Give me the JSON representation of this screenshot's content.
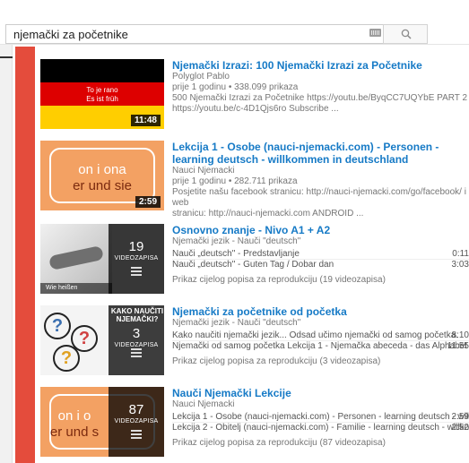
{
  "search": {
    "value": "njemački za početnike"
  },
  "colors": {
    "accent_red": "#e44c3c",
    "link_blue": "#167ac6"
  },
  "results": [
    {
      "title": "Njemački Izrazi: 100 Njemački Izrazi za Početnike",
      "channel": "Polyglot Pablo",
      "stats": "prije 1 godinu • 338.099 prikaza",
      "desc1": "500 Njemački Izrazi za Početnike https://youtu.be/ByqCC7UQYbE PART 2",
      "desc2": "https://youtu.be/c-4D1Qjs6ro Subscribe ...",
      "duration": "11:48",
      "thumb_text1": "To je rano",
      "thumb_text2": "Es ist früh"
    },
    {
      "title": "Lekcija 1 - Osobe (nauci-njemacki.com) - Personen - learning deutsch - willkommen in deutschland",
      "channel": "Nauci Njemacki",
      "stats": "prije 1 godinu • 282.711 prikaza",
      "desc1": "Posjetite našu facebook stranicu: http://nauci-njemacki.com/go/facebook/ i web",
      "desc2": "stranicu: http://nauci-njemacki.com ANDROID ...",
      "duration": "2:59",
      "thumb_text1": "on i ona",
      "thumb_text2": "er und sie"
    },
    {
      "title": "Osnovno znanje - Nivo A1 + A2",
      "channel": "Njemački jezik - Nauči \"deutsch\"",
      "count": "19",
      "count_label": "VIDEOZAPISA",
      "thumb_caption": "Wie heißen",
      "rows": [
        {
          "text": "Nauči „deutsch\" - Predstavljanje",
          "dur": "0:11"
        },
        {
          "text": "Nauči „deutsch\" - Guten Tag / Dobar dan",
          "dur": "3:03"
        }
      ],
      "view_all": "Prikaz cijelog popisa za reprodukciju (19 videozapisa)"
    },
    {
      "title": "Njemački za početnike od početka",
      "channel": "Njemački jezik - Nauči \"deutsch\"",
      "count": "3",
      "count_label": "VIDEOZAPISA",
      "overlay_text": "KAKO NAUČITI NJEMAČKI?",
      "rows": [
        {
          "text": "Kako naučiti njemački jezik... Odsad učimo njemački od samog početka.",
          "dur": "8:10"
        },
        {
          "text": "Njemački od samog početka Lekcija 1 - Njemačka abeceda - das Alphabet",
          "dur": "11:55"
        }
      ],
      "view_all": "Prikaz cijelog popisa za reprodukciju (3 videozapisa)"
    },
    {
      "title": "Nauči Njemački Lekcije",
      "channel": "Nauci Njemacki",
      "count": "87",
      "count_label": "VIDEOZAPISA",
      "thumb_text1": "on i o",
      "thumb_text2": "er und s",
      "rows": [
        {
          "text": "Lekcija 1 - Osobe (nauci-njemacki.com) - Personen - learning deutsch - willkom...",
          "dur": "2:59"
        },
        {
          "text": "Lekcija 2 - Obitelj (nauci-njemacki.com) - Familie - learning deutsch - willkomm...",
          "dur": "2:52"
        }
      ],
      "view_all": "Prikaz cijelog popisa za reprodukciju (87 videozapisa)"
    }
  ]
}
